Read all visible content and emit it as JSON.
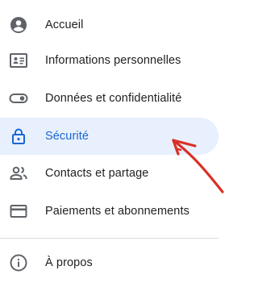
{
  "nav": {
    "items": [
      {
        "label": "Accueil",
        "icon": "account-circle-icon"
      },
      {
        "label": "Informations personnelles",
        "icon": "badge-icon"
      },
      {
        "label": "Données et confidentialité",
        "icon": "toggle-icon"
      },
      {
        "label": "Sécurité",
        "icon": "lock-icon",
        "active": true
      },
      {
        "label": "Contacts et partage",
        "icon": "people-icon"
      },
      {
        "label": "Paiements et abonnements",
        "icon": "credit-card-icon"
      }
    ],
    "footer_items": [
      {
        "label": "À propos",
        "icon": "info-icon"
      }
    ]
  },
  "colors": {
    "active_background": "#e8f0fe",
    "active_text": "#1967d2",
    "icon_default": "#5f6368",
    "text_default": "#202124",
    "divider": "#dadce0",
    "annotation_arrow": "#d93025"
  }
}
